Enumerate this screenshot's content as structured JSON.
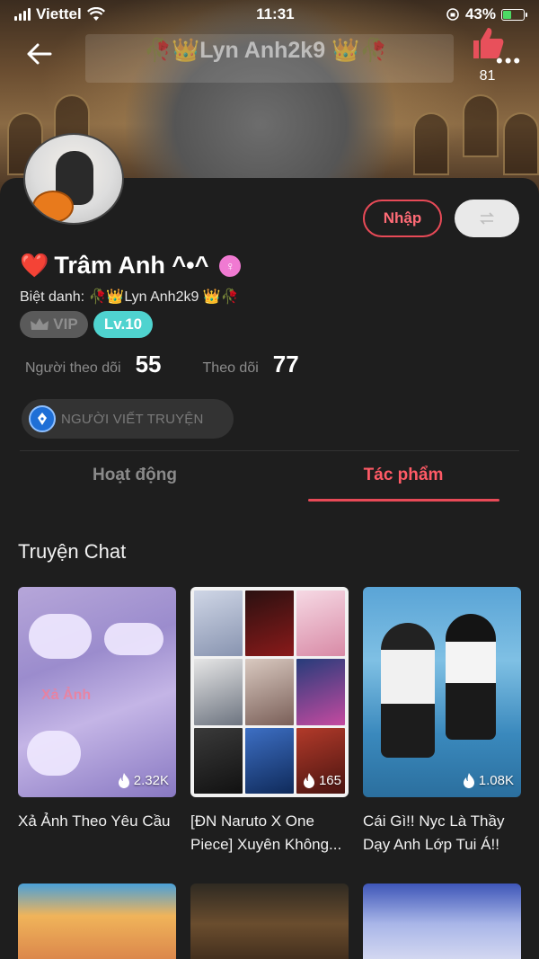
{
  "status_bar": {
    "carrier": "Viettel",
    "time": "11:31",
    "battery_percent": "43%",
    "battery_level": 0.43
  },
  "header": {
    "title": "🥀👑Lyn Anh2k9 👑🥀",
    "like_count": "81"
  },
  "profile": {
    "heart": "❤️",
    "name": "Trâm Anh ^•^",
    "nickname_label": "Biệt danh: ",
    "nickname": "🥀👑Lyn Anh2k9 👑🥀",
    "vip_label": "VIP",
    "level_label": "Lv.10",
    "import_button": "Nhập",
    "followers_label": "Người theo dõi",
    "followers_count": "55",
    "following_label": "Theo dõi",
    "following_count": "77",
    "writer_badge": "NGƯỜI VIẾT TRUYỆN"
  },
  "tabs": {
    "activity": "Hoạt động",
    "works": "Tác phẩm"
  },
  "section": {
    "title": "Truyện Chat"
  },
  "stories": [
    {
      "title": "Xả Ảnh Theo Yêu Cầu",
      "views": "2.32K",
      "watermark": "Xả Ảnh"
    },
    {
      "title": "[ĐN Naruto X One Piece] Xuyên Không...",
      "views": "165"
    },
    {
      "title": "Cái Gì!! Nyc Là Thầy Dạy Anh Lớp Tui Á!!",
      "views": "1.08K"
    }
  ],
  "colors": {
    "accent": "#e84a57",
    "background": "#1e1e1e",
    "level_badge": "#4fd3cf"
  }
}
